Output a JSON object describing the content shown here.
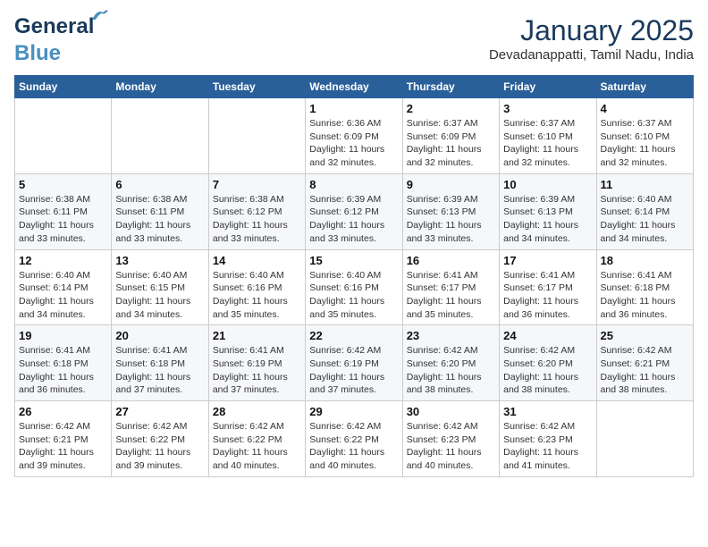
{
  "logo": {
    "general": "General",
    "blue": "Blue"
  },
  "header": {
    "month": "January 2025",
    "location": "Devadanappatti, Tamil Nadu, India"
  },
  "weekdays": [
    "Sunday",
    "Monday",
    "Tuesday",
    "Wednesday",
    "Thursday",
    "Friday",
    "Saturday"
  ],
  "weeks": [
    [
      {
        "day": "",
        "info": ""
      },
      {
        "day": "",
        "info": ""
      },
      {
        "day": "",
        "info": ""
      },
      {
        "day": "1",
        "info": "Sunrise: 6:36 AM\nSunset: 6:09 PM\nDaylight: 11 hours and 32 minutes."
      },
      {
        "day": "2",
        "info": "Sunrise: 6:37 AM\nSunset: 6:09 PM\nDaylight: 11 hours and 32 minutes."
      },
      {
        "day": "3",
        "info": "Sunrise: 6:37 AM\nSunset: 6:10 PM\nDaylight: 11 hours and 32 minutes."
      },
      {
        "day": "4",
        "info": "Sunrise: 6:37 AM\nSunset: 6:10 PM\nDaylight: 11 hours and 32 minutes."
      }
    ],
    [
      {
        "day": "5",
        "info": "Sunrise: 6:38 AM\nSunset: 6:11 PM\nDaylight: 11 hours and 33 minutes."
      },
      {
        "day": "6",
        "info": "Sunrise: 6:38 AM\nSunset: 6:11 PM\nDaylight: 11 hours and 33 minutes."
      },
      {
        "day": "7",
        "info": "Sunrise: 6:38 AM\nSunset: 6:12 PM\nDaylight: 11 hours and 33 minutes."
      },
      {
        "day": "8",
        "info": "Sunrise: 6:39 AM\nSunset: 6:12 PM\nDaylight: 11 hours and 33 minutes."
      },
      {
        "day": "9",
        "info": "Sunrise: 6:39 AM\nSunset: 6:13 PM\nDaylight: 11 hours and 33 minutes."
      },
      {
        "day": "10",
        "info": "Sunrise: 6:39 AM\nSunset: 6:13 PM\nDaylight: 11 hours and 34 minutes."
      },
      {
        "day": "11",
        "info": "Sunrise: 6:40 AM\nSunset: 6:14 PM\nDaylight: 11 hours and 34 minutes."
      }
    ],
    [
      {
        "day": "12",
        "info": "Sunrise: 6:40 AM\nSunset: 6:14 PM\nDaylight: 11 hours and 34 minutes."
      },
      {
        "day": "13",
        "info": "Sunrise: 6:40 AM\nSunset: 6:15 PM\nDaylight: 11 hours and 34 minutes."
      },
      {
        "day": "14",
        "info": "Sunrise: 6:40 AM\nSunset: 6:16 PM\nDaylight: 11 hours and 35 minutes."
      },
      {
        "day": "15",
        "info": "Sunrise: 6:40 AM\nSunset: 6:16 PM\nDaylight: 11 hours and 35 minutes."
      },
      {
        "day": "16",
        "info": "Sunrise: 6:41 AM\nSunset: 6:17 PM\nDaylight: 11 hours and 35 minutes."
      },
      {
        "day": "17",
        "info": "Sunrise: 6:41 AM\nSunset: 6:17 PM\nDaylight: 11 hours and 36 minutes."
      },
      {
        "day": "18",
        "info": "Sunrise: 6:41 AM\nSunset: 6:18 PM\nDaylight: 11 hours and 36 minutes."
      }
    ],
    [
      {
        "day": "19",
        "info": "Sunrise: 6:41 AM\nSunset: 6:18 PM\nDaylight: 11 hours and 36 minutes."
      },
      {
        "day": "20",
        "info": "Sunrise: 6:41 AM\nSunset: 6:18 PM\nDaylight: 11 hours and 37 minutes."
      },
      {
        "day": "21",
        "info": "Sunrise: 6:41 AM\nSunset: 6:19 PM\nDaylight: 11 hours and 37 minutes."
      },
      {
        "day": "22",
        "info": "Sunrise: 6:42 AM\nSunset: 6:19 PM\nDaylight: 11 hours and 37 minutes."
      },
      {
        "day": "23",
        "info": "Sunrise: 6:42 AM\nSunset: 6:20 PM\nDaylight: 11 hours and 38 minutes."
      },
      {
        "day": "24",
        "info": "Sunrise: 6:42 AM\nSunset: 6:20 PM\nDaylight: 11 hours and 38 minutes."
      },
      {
        "day": "25",
        "info": "Sunrise: 6:42 AM\nSunset: 6:21 PM\nDaylight: 11 hours and 38 minutes."
      }
    ],
    [
      {
        "day": "26",
        "info": "Sunrise: 6:42 AM\nSunset: 6:21 PM\nDaylight: 11 hours and 39 minutes."
      },
      {
        "day": "27",
        "info": "Sunrise: 6:42 AM\nSunset: 6:22 PM\nDaylight: 11 hours and 39 minutes."
      },
      {
        "day": "28",
        "info": "Sunrise: 6:42 AM\nSunset: 6:22 PM\nDaylight: 11 hours and 40 minutes."
      },
      {
        "day": "29",
        "info": "Sunrise: 6:42 AM\nSunset: 6:22 PM\nDaylight: 11 hours and 40 minutes."
      },
      {
        "day": "30",
        "info": "Sunrise: 6:42 AM\nSunset: 6:23 PM\nDaylight: 11 hours and 40 minutes."
      },
      {
        "day": "31",
        "info": "Sunrise: 6:42 AM\nSunset: 6:23 PM\nDaylight: 11 hours and 41 minutes."
      },
      {
        "day": "",
        "info": ""
      }
    ]
  ]
}
